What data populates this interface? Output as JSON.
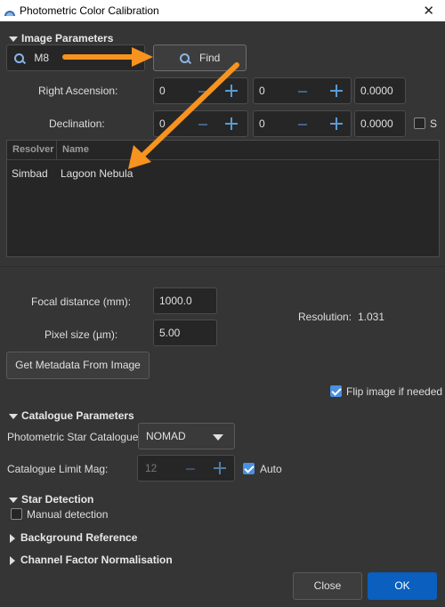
{
  "window": {
    "title": "Photometric Color Calibration",
    "close_glyph": "✕"
  },
  "image_parameters": {
    "header": "Image Parameters",
    "search_value": "M8",
    "find_label": "Find",
    "ra_label": "Right Ascension:",
    "ra_values": [
      "0",
      "0",
      "0.0000"
    ],
    "dec_label": "Declination:",
    "dec_values": [
      "0",
      "0",
      "0.0000"
    ],
    "dec_sign_label": "S",
    "table": {
      "headers": [
        "Resolver",
        "Name"
      ],
      "rows": [
        [
          "Simbad",
          "Lagoon Nebula"
        ]
      ]
    },
    "focal_label": "Focal distance (mm):",
    "focal_value": "1000.0",
    "pixel_label": "Pixel size (µm):",
    "pixel_value": "5.00",
    "resolution_label": "Resolution:",
    "resolution_value": "1.031",
    "metadata_button": "Get Metadata From Image",
    "flip_label": "Flip image if needed",
    "flip_checked": true
  },
  "catalogue_parameters": {
    "header": "Catalogue Parameters",
    "catalogue_label": "Photometric Star Catalogue:",
    "catalogue_value": "NOMAD",
    "limit_label": "Catalogue Limit Mag:",
    "limit_value": "12",
    "auto_label": "Auto",
    "auto_checked": true
  },
  "star_detection": {
    "header": "Star Detection",
    "manual_label": "Manual detection",
    "manual_checked": false
  },
  "background_reference": {
    "header": "Background Reference"
  },
  "channel_factor": {
    "header": "Channel Factor Normalisation"
  },
  "buttons": {
    "close": "Close",
    "ok": "OK"
  },
  "icons": [
    "app-icon",
    "search-icon",
    "close-icon",
    "plus-icon",
    "minus-icon",
    "checkbox-icon",
    "dropdown-arrow-icon"
  ],
  "colors": {
    "accent": "#4a90e2",
    "ok_button": "#0a5fbf",
    "annotation_arrow": "#f7931e",
    "background": "#353535"
  }
}
